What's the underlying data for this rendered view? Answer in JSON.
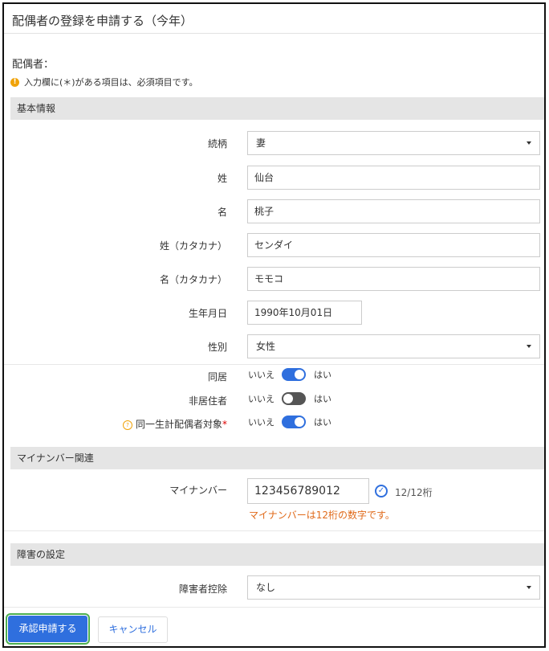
{
  "page": {
    "title": "配偶者の登録を申請する（今年）",
    "spouse_label": "配偶者：",
    "required_note": "入力欄に(＊)がある項目は、必須項目です。"
  },
  "sections": {
    "basic": "基本情報",
    "mynumber": "マイナンバー関連",
    "disability": "障害の設定"
  },
  "fields": {
    "relation": {
      "label": "続柄",
      "value": "妻"
    },
    "last_name": {
      "label": "姓",
      "value": "仙台"
    },
    "first_name": {
      "label": "名",
      "value": "桃子"
    },
    "last_kana": {
      "label": "姓（カタカナ）",
      "value": "センダイ"
    },
    "first_kana": {
      "label": "名（カタカナ）",
      "value": "モモコ"
    },
    "birthdate": {
      "label": "生年月日",
      "value": "1990年10月01日"
    },
    "gender": {
      "label": "性別",
      "value": "女性"
    },
    "mynumber": {
      "label": "マイナンバー",
      "value": "123456789012",
      "count": "12/12桁",
      "error": "マイナンバーは12桁の数字です。"
    },
    "disability": {
      "label": "障害者控除",
      "value": "なし"
    }
  },
  "toggles": {
    "no": "いいえ",
    "yes": "はい",
    "cohabit": {
      "label": "同居",
      "on": true
    },
    "nonresident": {
      "label": "非居住者",
      "on": false
    },
    "same_household": {
      "label": "同一生計配偶者対象",
      "required_mark": "*",
      "on": true
    }
  },
  "buttons": {
    "submit": "承認申請する",
    "cancel": "キャンセル"
  },
  "colors": {
    "accent": "#2f6fde",
    "error": "#e06a1a",
    "section_bg": "#e5e5e5"
  }
}
